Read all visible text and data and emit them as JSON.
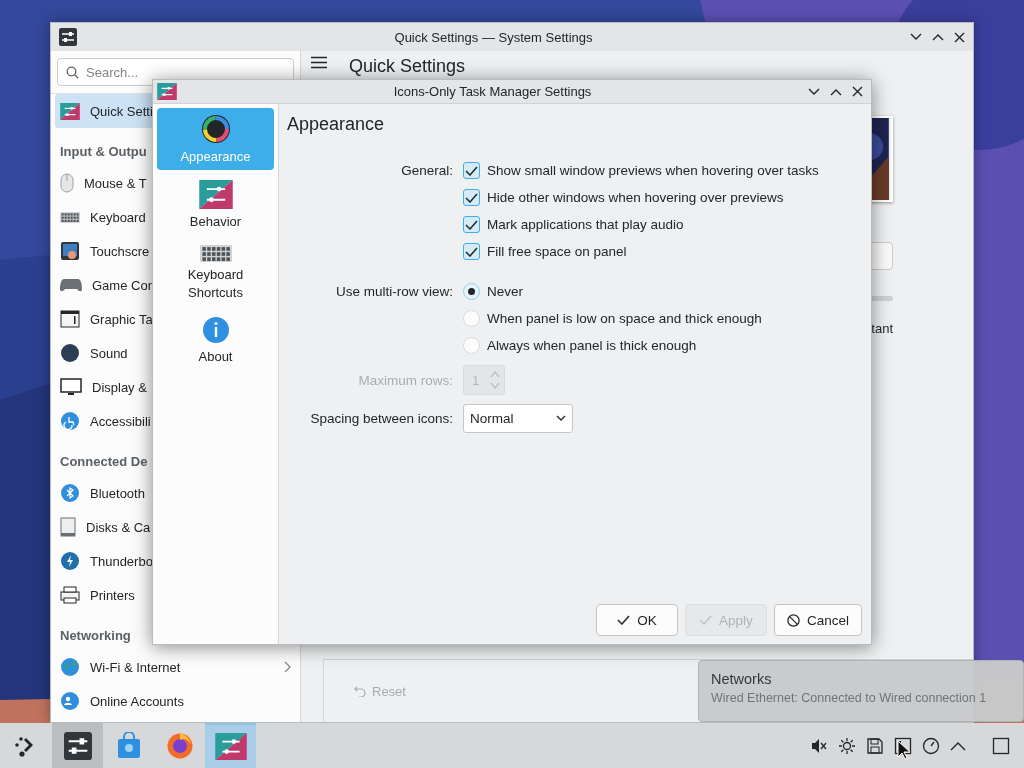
{
  "background_window": {
    "title": "Quick Settings — System Settings",
    "search": {
      "placeholder": "Search..."
    },
    "page_title": "Quick Settings",
    "sidebar": [
      {
        "kind": "item",
        "label": "Quick Setti",
        "selected": true
      },
      {
        "kind": "header",
        "label": "Input & Outpu"
      },
      {
        "kind": "item",
        "label": "Mouse & T",
        "selected": false
      },
      {
        "kind": "item",
        "label": "Keyboard",
        "selected": false
      },
      {
        "kind": "item",
        "label": "Touchscre",
        "selected": false
      },
      {
        "kind": "item",
        "label": "Game Con",
        "selected": false
      },
      {
        "kind": "item",
        "label": "Graphic Ta",
        "selected": false
      },
      {
        "kind": "item",
        "label": "Sound",
        "selected": false
      },
      {
        "kind": "item",
        "label": "Display &",
        "selected": false
      },
      {
        "kind": "item",
        "label": "Accessibili",
        "selected": false
      },
      {
        "kind": "header",
        "label": "Connected De"
      },
      {
        "kind": "item",
        "label": "Bluetooth",
        "selected": false
      },
      {
        "kind": "item",
        "label": "Disks & Ca",
        "selected": false
      },
      {
        "kind": "item",
        "label": "Thunderbo",
        "selected": false
      },
      {
        "kind": "item",
        "label": "Printers",
        "selected": false
      },
      {
        "kind": "header",
        "label": "Networking"
      },
      {
        "kind": "submenu",
        "label": "Wi-Fi & Internet",
        "selected": false
      },
      {
        "kind": "item",
        "label": "Online Accounts",
        "selected": false
      }
    ],
    "partial_label": "tant",
    "reset_button": {
      "label": "Reset",
      "disabled": true
    }
  },
  "dialog": {
    "title": "Icons-Only Task Manager Settings",
    "categories": [
      {
        "label": "Appearance",
        "selected": true
      },
      {
        "label": "Behavior",
        "selected": false
      },
      {
        "label": "Keyboard Shortcuts",
        "selected": false
      },
      {
        "label": "About",
        "selected": false
      }
    ],
    "page_title": "Appearance",
    "general_label": "General:",
    "checkboxes": [
      {
        "label": "Show small window previews when hovering over tasks",
        "checked": true
      },
      {
        "label": "Hide other windows when hovering over previews",
        "checked": true
      },
      {
        "label": "Mark applications that play audio",
        "checked": true
      },
      {
        "label": "Fill free space on panel",
        "checked": true
      }
    ],
    "multirow_label": "Use multi-row view:",
    "radios": [
      {
        "label": "Never",
        "selected": true
      },
      {
        "label": "When panel is low on space and thick enough",
        "selected": false
      },
      {
        "label": "Always when panel is thick enough",
        "selected": false
      }
    ],
    "max_rows": {
      "label": "Maximum rows:",
      "value": "1",
      "disabled": true
    },
    "spacing": {
      "label": "Spacing between icons:",
      "value": "Normal"
    },
    "buttons": [
      {
        "kind": "ok",
        "label": "OK",
        "disabled": false
      },
      {
        "kind": "apply",
        "label": "Apply",
        "disabled": true
      },
      {
        "kind": "cancel",
        "label": "Cancel",
        "disabled": false
      }
    ]
  },
  "notification": {
    "title": "Networks",
    "body": "Wired Ethernet: Connected to Wired connection 1"
  },
  "taskbar": {
    "tasks": [
      {
        "kind": "launcher",
        "open": false,
        "selected": false
      },
      {
        "kind": "settings",
        "open": true,
        "selected": false
      },
      {
        "kind": "store",
        "open": false,
        "selected": false
      },
      {
        "kind": "browser",
        "open": false,
        "selected": false
      },
      {
        "kind": "taskmanager",
        "open": true,
        "selected": true
      }
    ]
  }
}
